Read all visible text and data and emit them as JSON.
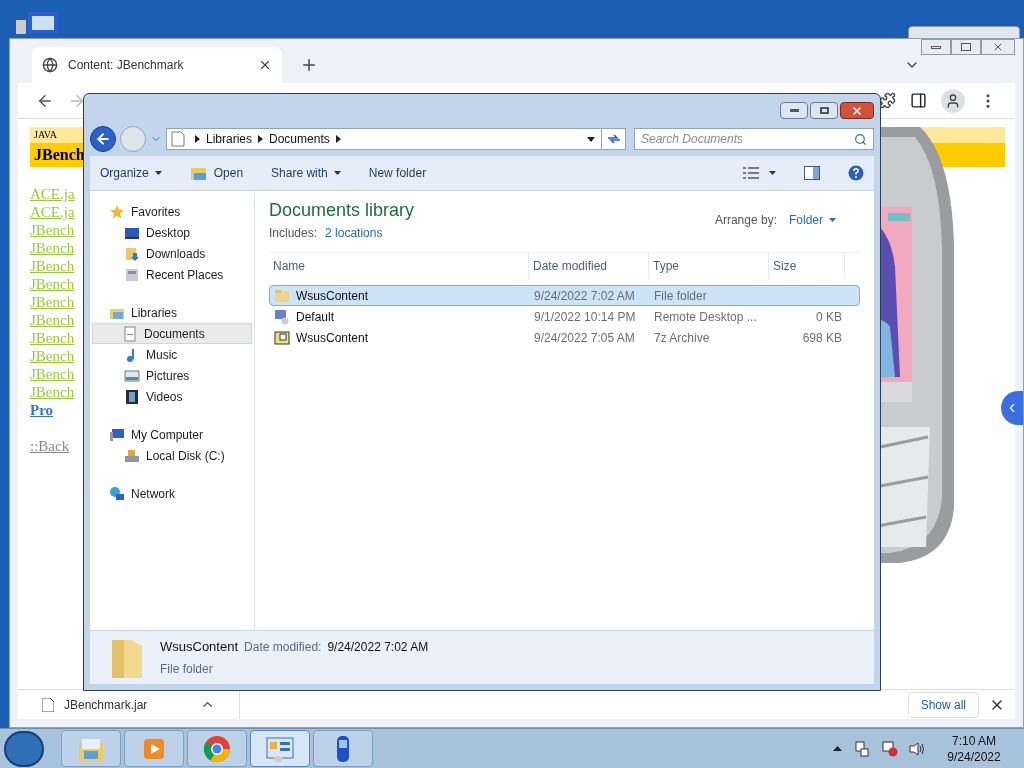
{
  "browser": {
    "tab": {
      "title": "Content: JBenchmark"
    },
    "page": {
      "header_label": "JAVA",
      "header_title": "JBench",
      "links": [
        "ACE.ja",
        "ACE.ja",
        "JBench",
        "JBench",
        "JBench",
        "JBench",
        "JBench",
        "JBench",
        "JBench",
        "JBench",
        "JBench",
        "JBench"
      ],
      "pro_link": "Pro",
      "back_link": "::Back"
    },
    "download": {
      "file": "JBenchmark.jar",
      "show_all": "Show all"
    }
  },
  "explorer": {
    "breadcrumb": [
      "Libraries",
      "Documents"
    ],
    "search": {
      "placeholder": "Search Documents"
    },
    "toolbar": [
      {
        "label": "Organize",
        "kind": "menu"
      },
      {
        "label": "Open",
        "kind": "open"
      },
      {
        "label": "Share with",
        "kind": "menu"
      },
      {
        "label": "New folder",
        "kind": "plain"
      }
    ],
    "nav": [
      {
        "label": "Favorites",
        "kind": "star",
        "children": [
          {
            "label": "Desktop",
            "kind": "desktop",
            "selected": false
          },
          {
            "label": "Downloads",
            "kind": "downloads",
            "selected": false
          },
          {
            "label": "Recent Places",
            "kind": "recent",
            "selected": false
          }
        ]
      },
      {
        "label": "Libraries",
        "kind": "libraries",
        "children": [
          {
            "label": "Documents",
            "kind": "document",
            "selected": true
          },
          {
            "label": "Music",
            "kind": "music",
            "selected": false
          },
          {
            "label": "Pictures",
            "kind": "pictures",
            "selected": false
          },
          {
            "label": "Videos",
            "kind": "videos",
            "selected": false
          }
        ]
      },
      {
        "label": "My Computer",
        "kind": "computer",
        "children": [
          {
            "label": "Local Disk (C:)",
            "kind": "disk",
            "selected": false
          }
        ]
      },
      {
        "label": "Network",
        "kind": "network"
      }
    ],
    "library": {
      "title": "Documents library",
      "includes_label": "Includes:",
      "includes_link": "2 locations",
      "arrange_label": "Arrange by:",
      "arrange_value": "Folder"
    },
    "columns": [
      "Name",
      "Date modified",
      "Type",
      "Size"
    ],
    "files": [
      {
        "name": "WsusContent",
        "date": "9/24/2022 7:02 AM",
        "type": "File folder",
        "kind": "folder",
        "selected": true
      },
      {
        "name": "Default",
        "date": "9/1/2022 10:14 PM",
        "type": "Remote Desktop ...",
        "size": "0 KB",
        "kind": "rdp",
        "selected": false
      },
      {
        "name": "WsusContent",
        "date": "9/24/2022 7:05 AM",
        "type": "7z Archive",
        "size": "698 KB",
        "kind": "archive",
        "selected": false
      }
    ],
    "details": {
      "name": "WsusContent",
      "date_label": "Date modified:",
      "date": "9/24/2022 7:02 AM",
      "type": "File folder"
    }
  },
  "taskbar": {
    "buttons": [
      {
        "kind": "explorer",
        "selected": false
      },
      {
        "kind": "media",
        "selected": false
      },
      {
        "kind": "chrome",
        "selected": false
      },
      {
        "kind": "control",
        "selected": true
      },
      {
        "kind": "phone",
        "selected": false
      }
    ],
    "clock": {
      "time": "7:10 AM",
      "date": "9/24/2022"
    }
  }
}
